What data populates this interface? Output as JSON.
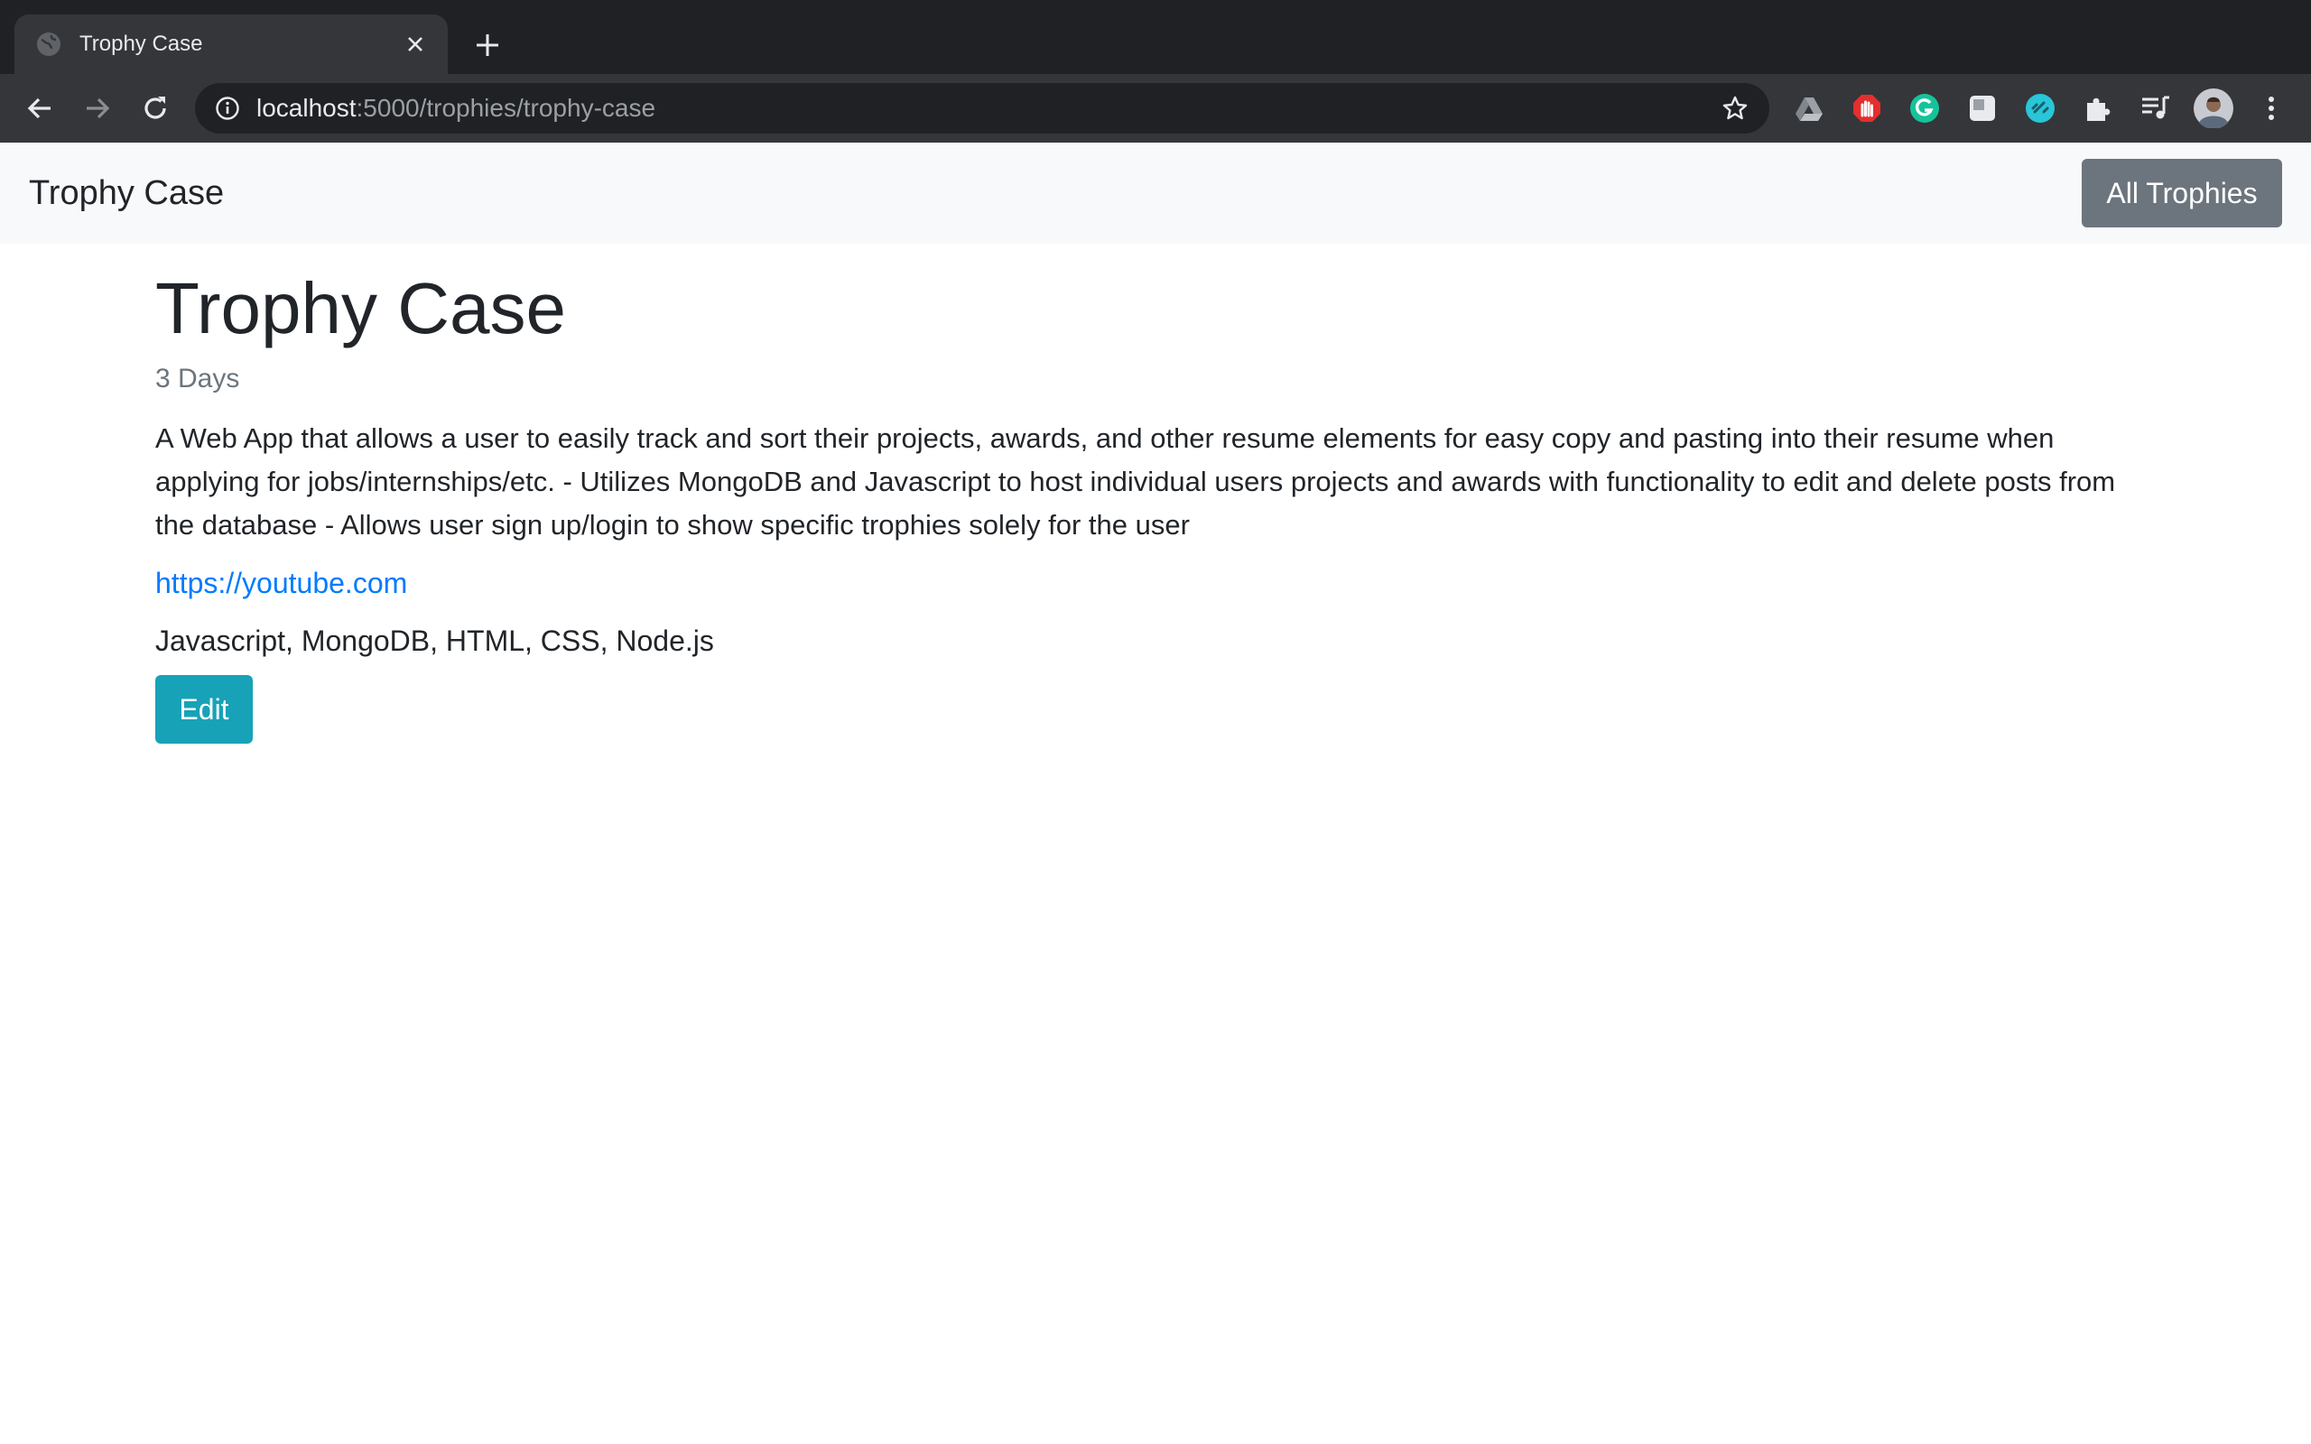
{
  "browser": {
    "tab": {
      "title": "Trophy Case",
      "favicon": "globe-icon"
    },
    "address": {
      "host": "localhost",
      "path": ":5000/trophies/trophy-case"
    },
    "extensions": [
      "google-drive-icon",
      "adblock-icon",
      "grammarly-icon",
      "notion-icon",
      "link-extension-icon",
      "puzzle-icon",
      "media-control-icon",
      "avatar",
      "kebab-menu-icon"
    ]
  },
  "navbar": {
    "brand": "Trophy Case",
    "all_trophies_label": "All Trophies"
  },
  "trophy": {
    "title": "Trophy Case",
    "duration": "3 Days",
    "description": "A Web App that allows a user to easily track and sort their projects, awards, and other resume elements for easy copy and pasting into their resume when applying for jobs/internships/etc. - Utilizes MongoDB and Javascript to host individual users projects and awards with functionality to edit and delete posts from the database - Allows user sign up/login to show specific trophies solely for the user",
    "link": "https://youtube.com",
    "technologies": "Javascript, MongoDB, HTML, CSS, Node.js",
    "edit_label": "Edit"
  },
  "colors": {
    "primary_link": "#007bff",
    "secondary_button": "#6c757d",
    "info_button": "#17a2b8"
  }
}
